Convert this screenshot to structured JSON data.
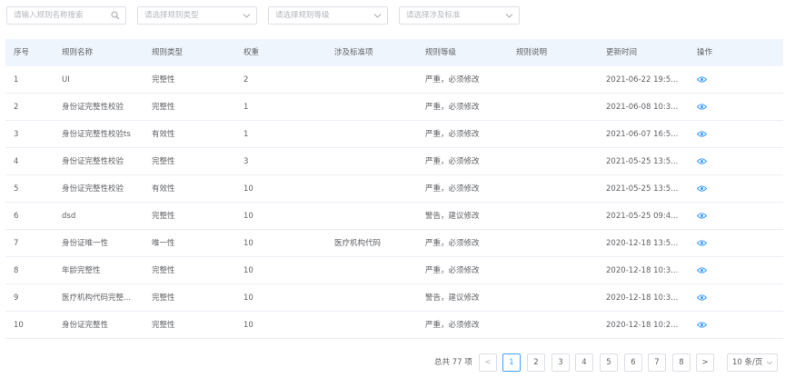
{
  "filters": {
    "name_placeholder": "请输入规则名称搜索",
    "type_placeholder": "请选择规则类型",
    "level_placeholder": "请选择规则等级",
    "standard_placeholder": "请选择涉及标准"
  },
  "table": {
    "headers": {
      "index": "序号",
      "name": "规则名称",
      "type": "规则类型",
      "weight": "权重",
      "standard": "涉及标准项",
      "level": "规则等级",
      "desc": "规则说明",
      "updated": "更新时间",
      "action": "操作"
    },
    "rows": [
      {
        "index": "1",
        "name": "UI",
        "type": "完整性",
        "weight": "2",
        "standard": "",
        "level": "严重，必须修改",
        "desc": "",
        "updated": "2021-06-22 19:5..."
      },
      {
        "index": "2",
        "name": "身份证完整性校验",
        "type": "完整性",
        "weight": "1",
        "standard": "",
        "level": "严重，必须修改",
        "desc": "",
        "updated": "2021-06-08 10:3..."
      },
      {
        "index": "3",
        "name": "身份证完整性校验ts",
        "type": "有效性",
        "weight": "1",
        "standard": "",
        "level": "严重，必须修改",
        "desc": "",
        "updated": "2021-06-07 16:5..."
      },
      {
        "index": "4",
        "name": "身份证完整性校验",
        "type": "完整性",
        "weight": "3",
        "standard": "",
        "level": "严重，必须修改",
        "desc": "",
        "updated": "2021-05-25 13:5..."
      },
      {
        "index": "5",
        "name": "身份证完整性校验",
        "type": "有效性",
        "weight": "10",
        "standard": "",
        "level": "严重，必须修改",
        "desc": "",
        "updated": "2021-05-25 13:5..."
      },
      {
        "index": "6",
        "name": "dsd",
        "type": "完整性",
        "weight": "10",
        "standard": "",
        "level": "警告，建议修改",
        "desc": "",
        "updated": "2021-05-25 09:4..."
      },
      {
        "index": "7",
        "name": "身份证唯一性",
        "type": "唯一性",
        "weight": "10",
        "standard": "医疗机构代码",
        "level": "严重，必须修改",
        "desc": "",
        "updated": "2020-12-18 13:5..."
      },
      {
        "index": "8",
        "name": "年龄完整性",
        "type": "完整性",
        "weight": "10",
        "standard": "",
        "level": "严重，必须修改",
        "desc": "",
        "updated": "2020-12-18 10:3..."
      },
      {
        "index": "9",
        "name": "医疗机构代码完整...",
        "type": "完整性",
        "weight": "10",
        "standard": "",
        "level": "警告，建议修改",
        "desc": "",
        "updated": "2020-12-18 10:3..."
      },
      {
        "index": "10",
        "name": "身份证完整性",
        "type": "完整性",
        "weight": "10",
        "standard": "",
        "level": "严重，必须修改",
        "desc": "",
        "updated": "2020-12-18 10:2..."
      }
    ]
  },
  "pagination": {
    "total_text": "总共 77 项",
    "prev": "<",
    "next": ">",
    "pages": [
      "1",
      "2",
      "3",
      "4",
      "5",
      "6",
      "7",
      "8"
    ],
    "current": "1",
    "page_size": "10 条/页"
  },
  "colors": {
    "accent": "#409eff",
    "header_bg": "#eef5fc"
  },
  "icons": {
    "search": "search-icon",
    "dropdown": "chevron-down-icon",
    "view": "eye-icon"
  }
}
